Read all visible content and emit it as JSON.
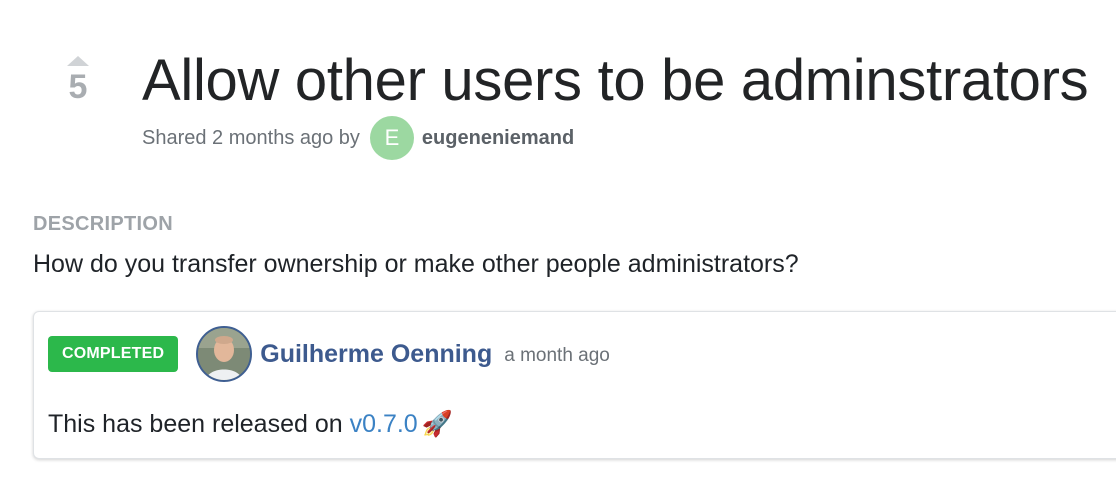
{
  "post": {
    "votes": "5",
    "title": "Allow other users to be adminstrators",
    "shared_prefix": "Shared 2 months ago by",
    "author_initial": "E",
    "author_name": "eugeneniemand",
    "avatar_color": "#9cd8a1"
  },
  "description": {
    "heading": "DESCRIPTION",
    "text": "How do you transfer ownership or make other people administrators?"
  },
  "status_update": {
    "badge": "COMPLETED",
    "badge_color": "#2cb84b",
    "author_name": "Guilherme Oenning",
    "time": "a month ago",
    "body_prefix": "This has been released on ",
    "release_link": "v0.7.0",
    "emoji": "🚀"
  },
  "icons": {
    "upvote": "upvote-arrow-icon",
    "rocket": "rocket-icon"
  }
}
